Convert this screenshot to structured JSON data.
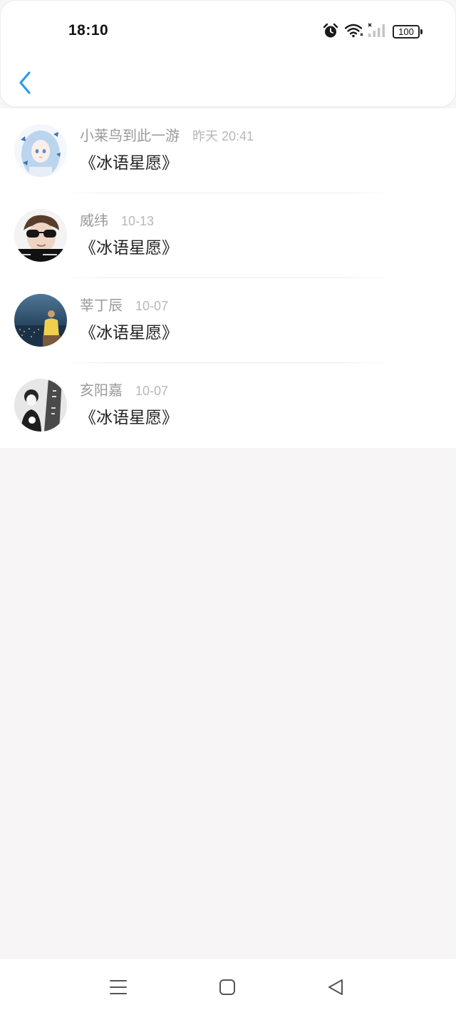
{
  "status_bar": {
    "time": "18:10",
    "battery": "100",
    "icons": [
      "alarm-icon",
      "wifi-icon",
      "signal-icon",
      "battery-icon"
    ]
  },
  "header": {
    "back_icon": "chevron-left-icon"
  },
  "comments": [
    {
      "name": "小莱鸟到此一游",
      "time": "昨天 20:41",
      "content": "《冰语星愿》"
    },
    {
      "name": "威纬",
      "time": "10-13",
      "content": "《冰语星愿》"
    },
    {
      "name": "莘丁辰",
      "time": "10-07",
      "content": "《冰语星愿》"
    },
    {
      "name": "亥阳嘉",
      "time": "10-07",
      "content": "《冰语星愿》"
    }
  ],
  "nav_bar": {
    "icons": [
      "menu-icon",
      "home-square-icon",
      "back-triangle-icon"
    ]
  },
  "colors": {
    "accent": "#2e9be6",
    "name": "#9a9a9a",
    "time": "#b8b8b8",
    "content": "#222222",
    "page_background": "#f7f5f6"
  }
}
